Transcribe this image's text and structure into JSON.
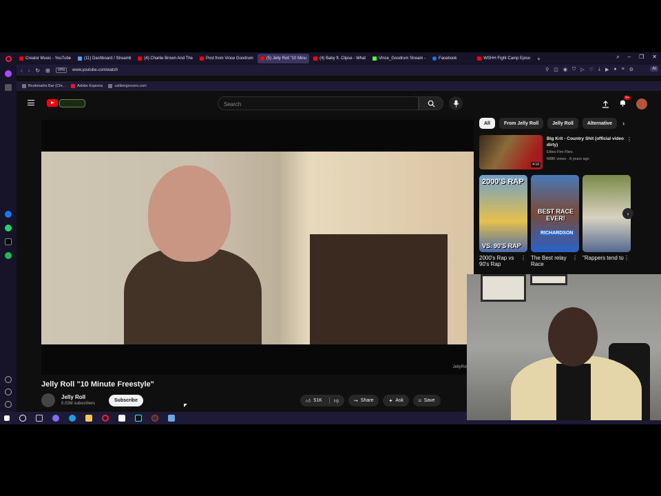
{
  "browser": {
    "tabs": [
      {
        "label": "Creator Music - YouTube",
        "color": "#ff0000"
      },
      {
        "label": "(11) Dashboard / Streamli",
        "color": "#4aa3ff"
      },
      {
        "label": "(4) Charlie Brown And The",
        "color": "#ff0000"
      },
      {
        "label": "Post from Vince Goodrum",
        "color": "#ff0000"
      },
      {
        "label": "(5) Jelly Roll \"10 Minu",
        "color": "#ff0000",
        "active": true
      },
      {
        "label": "(4) Baby ft. Clipse - What",
        "color": "#ff0000"
      },
      {
        "label": "Vince_Goodrum Stream -",
        "color": "#53fc18"
      },
      {
        "label": "Facebook",
        "color": "#1877f2"
      },
      {
        "label": "WSHH Fight Camp Episo",
        "color": "#ff0000"
      }
    ],
    "url": "www.youtube.com/watch",
    "vpn_label": "VPN",
    "ai_label": "AI",
    "bookmarks": [
      "Bookmarks Bar (Chr...",
      "Adobe Express",
      "calibergrocers.com"
    ]
  },
  "youtube": {
    "search_placeholder": "Search",
    "notifications_count": "9+",
    "video_title": "Jelly Roll \"10 Minute Freestyle\"",
    "watermark": "JellyRoll",
    "channel_name": "Jelly Roll",
    "channel_subs": "5.02M subscribers",
    "subscribe_label": "Subscribe",
    "likes": "51K",
    "share_label": "Share",
    "ask_label": "Ask",
    "save_label": "Save",
    "chips": [
      "All",
      "From Jelly Roll",
      "Jelly Roll",
      "Alternative"
    ],
    "recommendation": {
      "title": "Big Krit - Country Shit (official video dirty)",
      "channel": "Elites Fire Flies",
      "meta": "688K views · 8 years ago",
      "duration": "4:10"
    },
    "shorts": [
      {
        "title": "2000's Rap vs 90's Rap",
        "label_top": "2000'S RAP",
        "label_bottom": "VS. 90'S RAP"
      },
      {
        "title": "The Best relay Race",
        "label_top": "BEST RACE EVER!",
        "label_bottom": "RICHARDSON"
      },
      {
        "title": "\"Rappers tend to",
        "label_top": "",
        "label_bottom": ""
      }
    ]
  }
}
